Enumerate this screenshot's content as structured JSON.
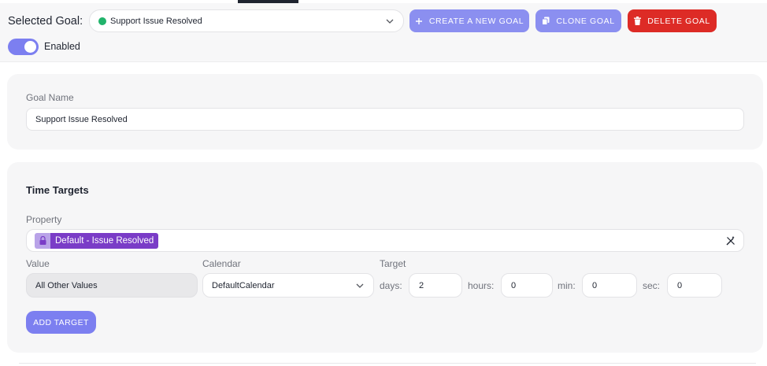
{
  "header": {
    "selected_goal_label": "Selected Goal:",
    "selected_goal_value": "Support Issue Resolved",
    "status_color": "#21b36b",
    "create_label": "CREATE A NEW GOAL",
    "clone_label": "CLONE GOAL",
    "delete_label": "DELETE GOAL",
    "enabled_label": "Enabled",
    "enabled": true
  },
  "goal_name": {
    "label": "Goal Name",
    "value": "Support Issue Resolved"
  },
  "time_targets": {
    "title": "Time Targets",
    "property_label": "Property",
    "property_chip": "Default - Issue Resolved",
    "value_label": "Value",
    "value": "All Other Values",
    "calendar_label": "Calendar",
    "calendar_value": "DefaultCalendar",
    "target_label": "Target",
    "days_label": "days:",
    "days_value": "2",
    "hours_label": "hours:",
    "hours_value": "0",
    "min_label": "min:",
    "min_value": "0",
    "sec_label": "sec:",
    "sec_value": "0",
    "add_target_label": "ADD TARGET"
  },
  "colors": {
    "accent": "#8b8ff0",
    "danger": "#dd2b26",
    "chip": "#7a3cc7"
  },
  "icons": {
    "create": "plus-icon",
    "clone": "copy-icon",
    "delete": "trash-icon",
    "dropdown": "chevron-down-icon",
    "property": "lock-icon",
    "clear": "magic-wand-icon"
  }
}
